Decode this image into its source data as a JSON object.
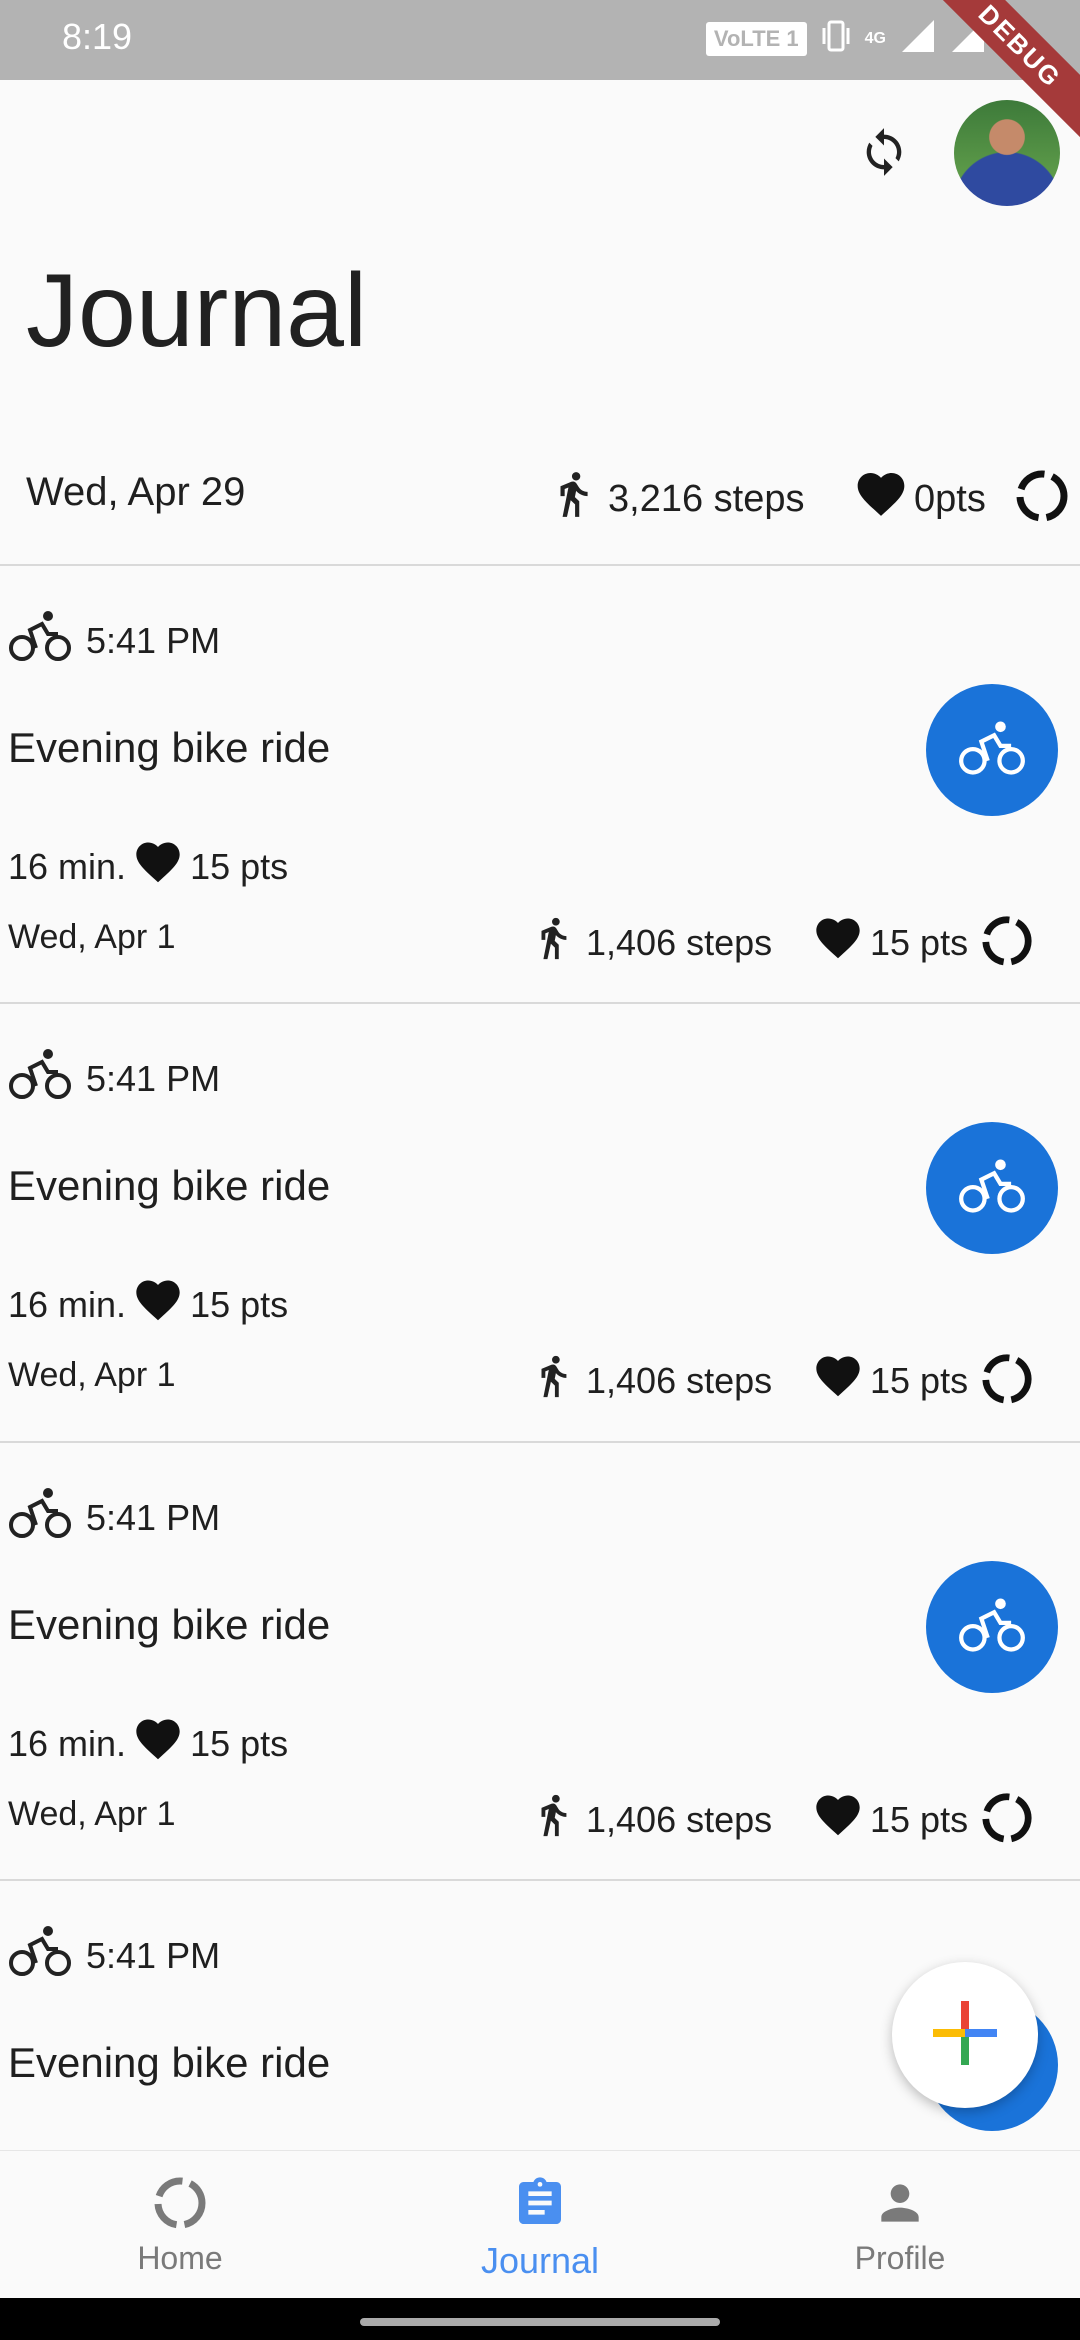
{
  "status_bar": {
    "time": "8:19",
    "volte": "VoLTE 1",
    "network": "4G",
    "debug": "DEBUG"
  },
  "header": {
    "title": "Journal"
  },
  "day_summary": {
    "date": "Wed, Apr 29",
    "steps": "3,216 steps",
    "points": "0pts"
  },
  "entries": [
    {
      "time": "5:41 PM",
      "title": "Evening bike ride",
      "duration": "16 min.",
      "points": "15 pts",
      "date": "Wed, Apr 1",
      "steps": "1,406 steps",
      "day_points": "15 pts"
    },
    {
      "time": "5:41 PM",
      "title": "Evening bike ride",
      "duration": "16 min.",
      "points": "15 pts",
      "date": "Wed, Apr 1",
      "steps": "1,406 steps",
      "day_points": "15 pts"
    },
    {
      "time": "5:41 PM",
      "title": "Evening bike ride",
      "duration": "16 min.",
      "points": "15 pts",
      "date": "Wed, Apr 1",
      "steps": "1,406 steps",
      "day_points": "15 pts"
    },
    {
      "time": "5:41 PM",
      "title": "Evening bike ride"
    }
  ],
  "nav": {
    "home": "Home",
    "journal": "Journal",
    "profile": "Profile"
  },
  "colors": {
    "accent": "#1a73d9",
    "nav_active": "#4a8ff0"
  }
}
